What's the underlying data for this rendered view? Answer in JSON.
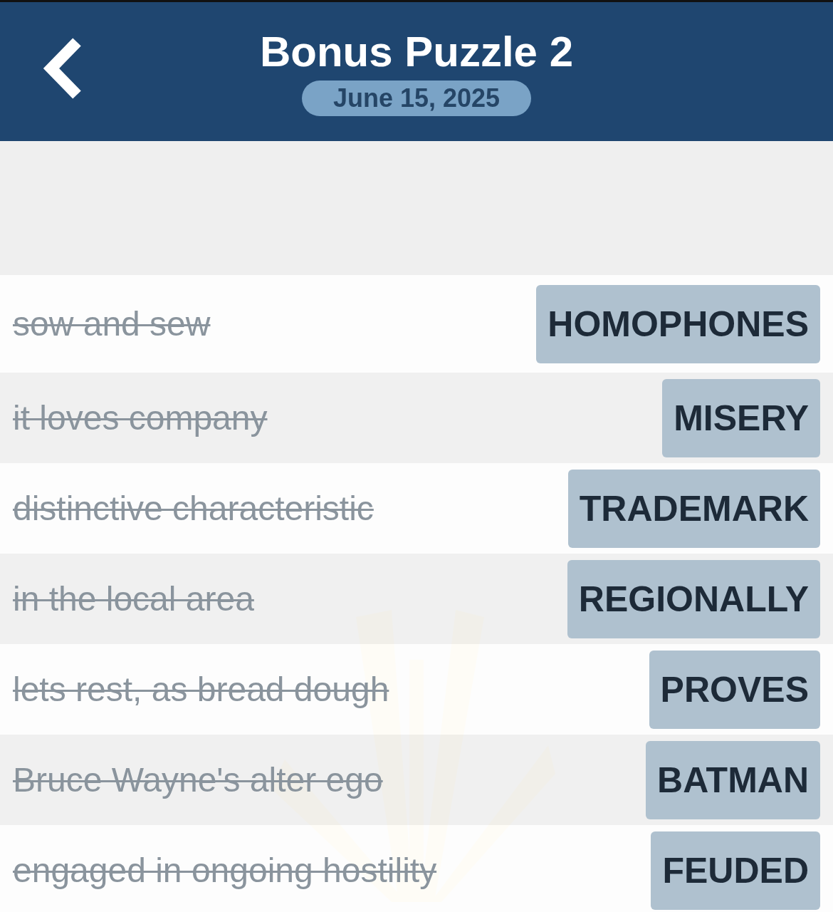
{
  "header": {
    "title": "Bonus Puzzle 2",
    "date": "June 15, 2025"
  },
  "clues": [
    {
      "clue": "sow and sew",
      "answer": "HOMOPHONES",
      "solved": true
    },
    {
      "clue": "it loves company",
      "answer": "MISERY",
      "solved": true
    },
    {
      "clue": "distinctive characteristic",
      "answer": "TRADEMARK",
      "solved": true
    },
    {
      "clue": "in the local area",
      "answer": "REGIONALLY",
      "solved": true
    },
    {
      "clue": "lets rest, as bread dough",
      "answer": "PROVES",
      "solved": true
    },
    {
      "clue": "Bruce Wayne's alter ego",
      "answer": "BATMAN",
      "solved": true
    },
    {
      "clue": "engaged in ongoing hostility",
      "answer": "FEUDED",
      "solved": true
    }
  ]
}
